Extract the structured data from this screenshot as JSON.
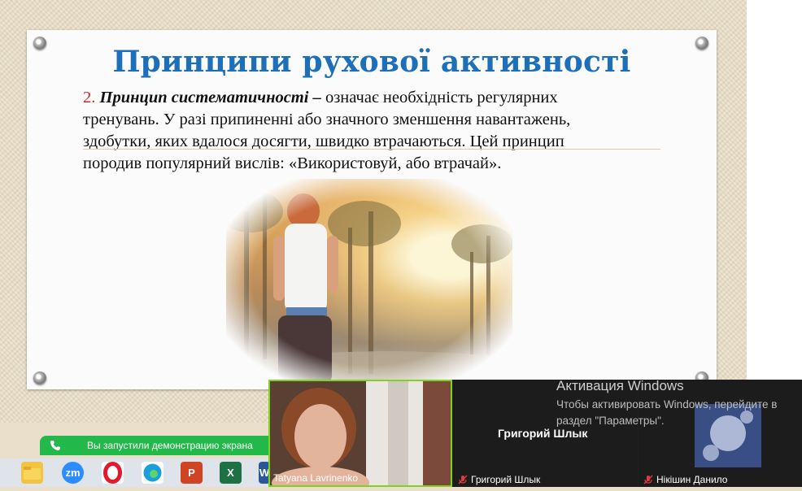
{
  "slide": {
    "title": "Принципи рухової активності",
    "number": "2.",
    "term": "Принцип систематичності –",
    "line1_rest": " означає необхідність регулярних",
    "line2": "тренувань. У разі припиненні або значного зменшення навантажень,",
    "line3": "здобутки, яких вдалося досягти, швидко втрачаються. Цей принцип",
    "line4": "породив популярний вислів: «Використовуй, або втрачай»."
  },
  "screen_share": {
    "notice": "Вы запустили демонстрацию экрана"
  },
  "taskbar": {
    "zoom_label": "zm",
    "excel_label": "X",
    "word_label": "W",
    "ppt_label": "P"
  },
  "participants": [
    {
      "name": "Tatyana Lavrinenko",
      "muted": false,
      "active": true
    },
    {
      "name": "Григорий Шлык",
      "display_name": "Григорий Шлык",
      "muted": true
    },
    {
      "name": "Нікішин Данило",
      "muted": true
    }
  ],
  "windows_activation": {
    "title": "Активация Windows",
    "line1": "Чтобы активировать Windows, перейдите в",
    "line2": "раздел \"Параметры\"."
  },
  "colors": {
    "title": "#1c6fb8",
    "number": "#d0242a",
    "share_bar": "#23b84a",
    "active_tile_border": "#7ed321"
  }
}
